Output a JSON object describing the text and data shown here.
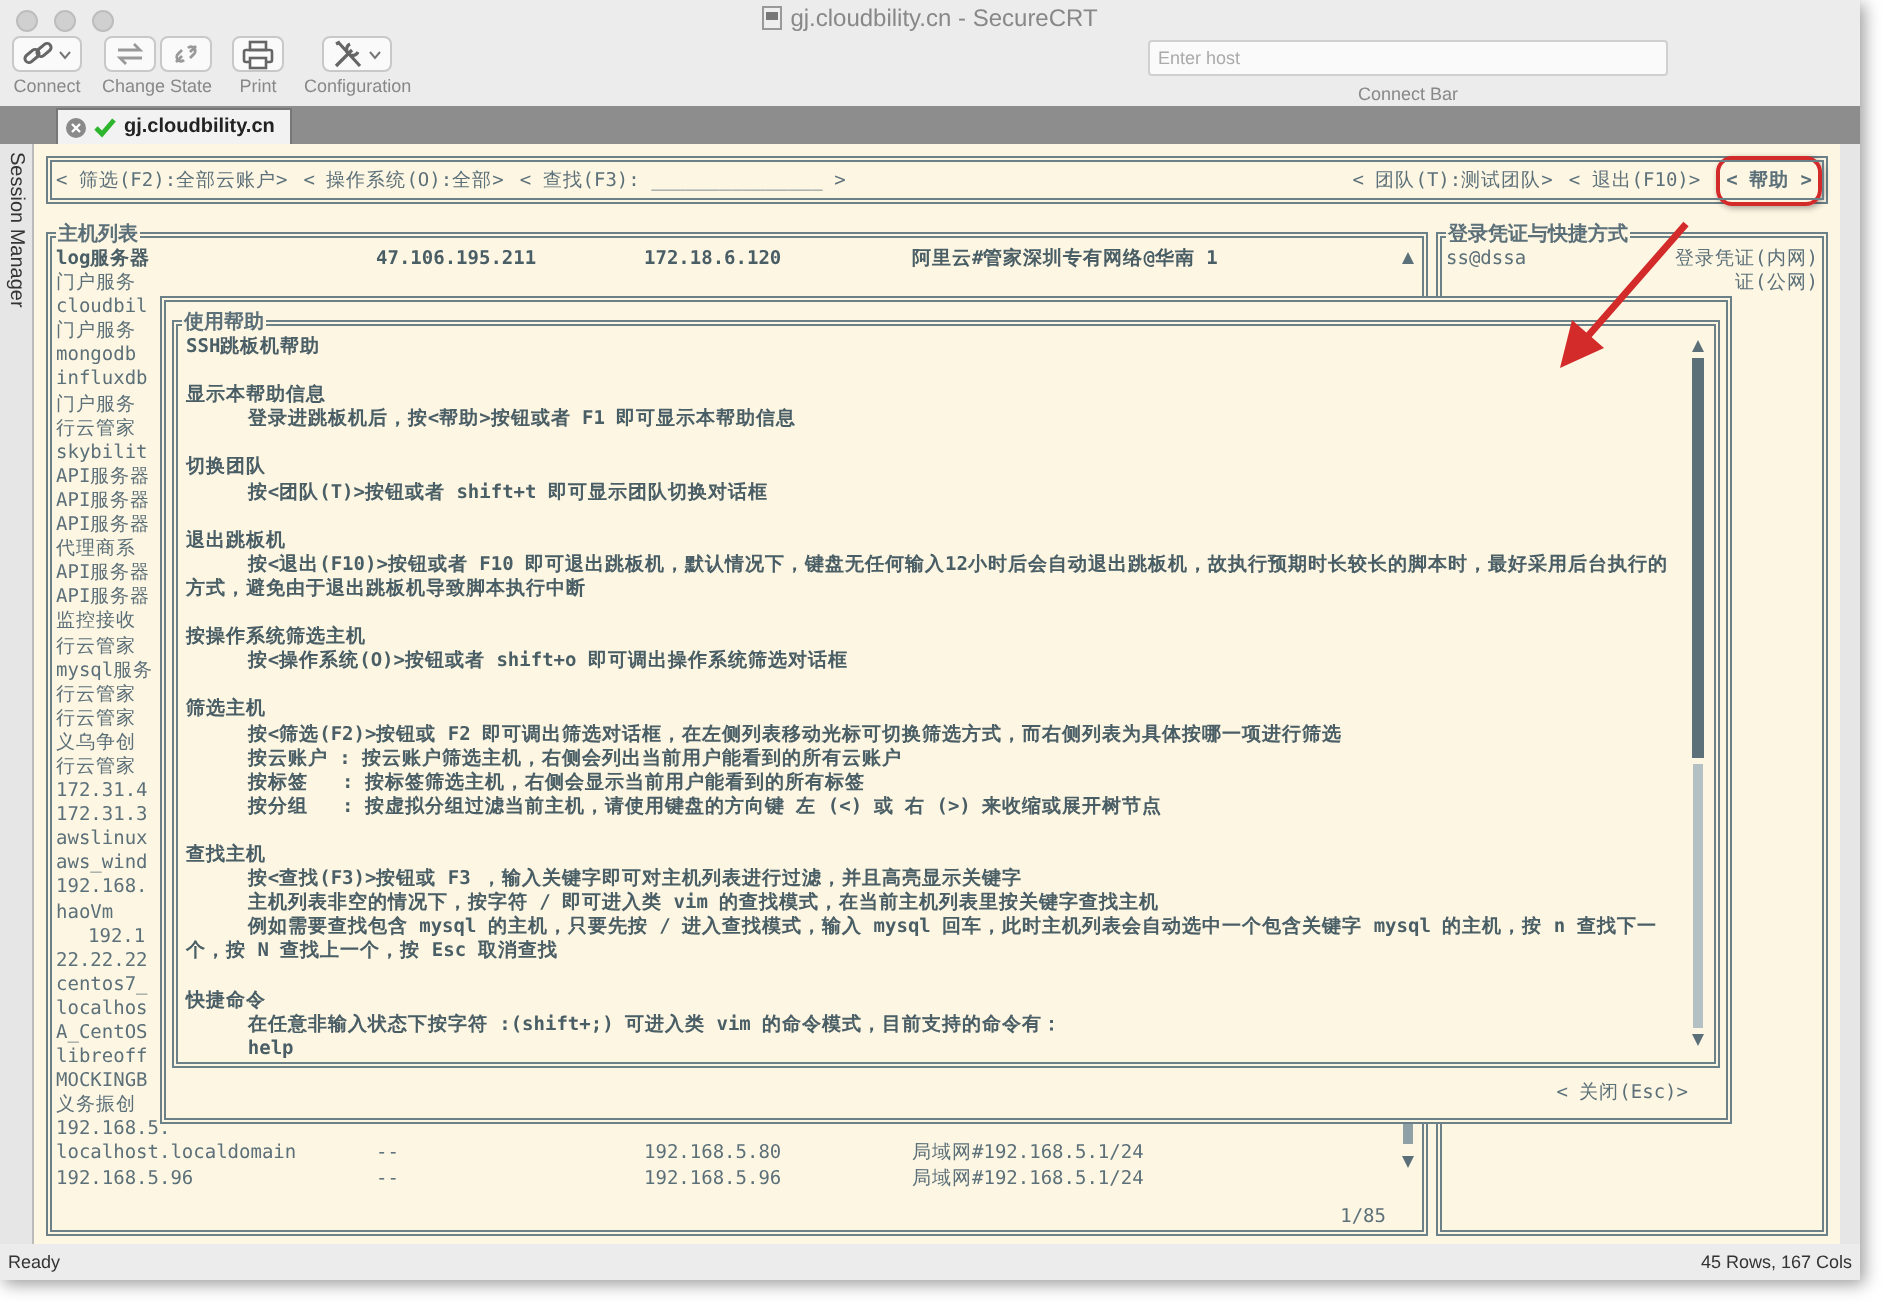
{
  "window": {
    "title": "gj.cloudbility.cn - SecureCRT"
  },
  "toolbar": {
    "buttons": [
      {
        "label": "Connect",
        "kind": "link",
        "dropdown": true
      },
      {
        "label": "Change State",
        "kind": "state",
        "dropdown": false
      },
      {
        "label": "Print",
        "kind": "print",
        "dropdown": false
      },
      {
        "label": "Configuration",
        "kind": "tools",
        "dropdown": true
      }
    ],
    "host_field": {
      "placeholder": "Enter host"
    },
    "connect_bar_label": "Connect Bar"
  },
  "session_tab": {
    "label": "gj.cloudbility.cn",
    "connected": true
  },
  "sidebar": {
    "label": "Session Manager"
  },
  "terminal": {
    "menu_left": [
      {
        "label": "< 筛选(F2):全部云账户>",
        "annotated": false
      },
      {
        "label": "< 操作系统(O):全部>",
        "annotated": false
      },
      {
        "label": "< 查找(F3): _______________ >",
        "annotated": false
      }
    ],
    "menu_right": [
      {
        "label": "< 团队(T):测试团队>",
        "annotated": false
      },
      {
        "label": "< 退出(F10)>",
        "annotated": false
      },
      {
        "label": "< 帮助 >",
        "annotated": true
      }
    ],
    "host_list": {
      "title": "主机列表",
      "rows": [
        {
          "name": "log服务器",
          "public_ip": "47.106.195.211",
          "private_ip": "172.18.6.120",
          "network": "阿里云#管家深圳专有网络@华南 1",
          "selected": true
        },
        {
          "name": "门户服务",
          "selected": false
        },
        {
          "name": "cloudbil",
          "selected": false
        },
        {
          "name": "门户服务",
          "selected": false
        },
        {
          "name": "mongodb",
          "selected": false
        },
        {
          "name": "influxdb",
          "selected": false
        },
        {
          "name": "门户服务",
          "selected": false
        },
        {
          "name": "行云管家",
          "selected": false
        },
        {
          "name": "skybilit",
          "selected": false
        },
        {
          "name": "API服务器",
          "selected": false
        },
        {
          "name": "API服务器",
          "selected": false
        },
        {
          "name": "API服务器",
          "selected": false
        },
        {
          "name": "代理商系",
          "selected": false
        },
        {
          "name": "API服务器",
          "selected": false
        },
        {
          "name": "API服务器",
          "selected": false
        },
        {
          "name": "监控接收",
          "selected": false
        },
        {
          "name": "行云管家",
          "selected": false
        },
        {
          "name": "mysql服务",
          "selected": false
        },
        {
          "name": "行云管家",
          "selected": false
        },
        {
          "name": "行云管家",
          "selected": false
        },
        {
          "name": "义乌争创",
          "selected": false
        },
        {
          "name": "行云管家",
          "selected": false
        },
        {
          "name": "172.31.4",
          "selected": false
        },
        {
          "name": "172.31.3",
          "selected": false
        },
        {
          "name": "awslinux",
          "selected": false
        },
        {
          "name": "aws_wind",
          "selected": false
        },
        {
          "name": "192.168.",
          "selected": false
        },
        {
          "name": "haoVm",
          "selected": false,
          "children": [
            {
              "name": "192.1",
              "selected": false
            }
          ]
        },
        {
          "name": "22.22.22",
          "selected": false
        },
        {
          "name": "centos7_",
          "selected": false
        },
        {
          "name": "localhos",
          "selected": false
        },
        {
          "name": "A_CentOS",
          "selected": false
        },
        {
          "name": "libreoff",
          "selected": false
        },
        {
          "name": "MOCKINGB",
          "selected": false
        },
        {
          "name": "义务振创",
          "selected": false
        },
        {
          "name": "192.168.5.",
          "selected": false
        },
        {
          "name": "localhost.localdomain",
          "public_ip": "--",
          "private_ip": "192.168.5.80",
          "network": "局域网#192.168.5.1/24",
          "selected": false
        },
        {
          "name": "192.168.5.96",
          "public_ip": "--",
          "private_ip": "192.168.5.96",
          "network": "局域网#192.168.5.1/24",
          "selected": false
        }
      ],
      "page": "1/85"
    },
    "credentials": {
      "title": "登录凭证与快捷方式",
      "rows": [
        {
          "user": "ss@dssa",
          "label": "登录凭证(内网)"
        },
        {
          "label": "证(公网)"
        }
      ]
    },
    "help_dialog": {
      "title": "使用帮助",
      "heading": "SSH跳板机帮助",
      "sections": [
        {
          "heading": "显示本帮助信息",
          "lines": [
            "登录进跳板机后，按<帮助>按钮或者 F1 即可显示本帮助信息"
          ]
        },
        {
          "heading": "切换团队",
          "lines": [
            "按<团队(T)>按钮或者 shift+t 即可显示团队切换对话框"
          ]
        },
        {
          "heading": "退出跳板机",
          "lines": [
            "按<退出(F10)>按钮或者 F10 即可退出跳板机，默认情况下，键盘无任何输入12小时后会自动退出跳板机，故执行预期时长较长的脚本时，最好采用后台执行的方式，避免由于退出跳板机导致脚本执行中断"
          ]
        },
        {
          "heading": "按操作系统筛选主机",
          "lines": [
            "按<操作系统(O)>按钮或者 shift+o 即可调出操作系统筛选对话框"
          ]
        },
        {
          "heading": "筛选主机",
          "lines": [
            "按<筛选(F2)>按钮或 F2 即可调出筛选对话框，在左侧列表移动光标可切换筛选方式，而右侧列表为具体按哪一项进行筛选",
            "按云账户 : 按云账户筛选主机，右侧会列出当前用户能看到的所有云账户",
            "按标签   : 按标签筛选主机，右侧会显示当前用户能看到的所有标签",
            "按分组   : 按虚拟分组过滤当前主机，请使用键盘的方向键 左 (<) 或 右 (>) 来收缩或展开树节点"
          ]
        },
        {
          "heading": "查找主机",
          "lines": [
            "按<查找(F3)>按钮或 F3 ，输入关键字即可对主机列表进行过滤，并且高亮显示关键字",
            "主机列表非空的情况下，按字符 / 即可进入类 vim 的查找模式，在当前主机列表里按关键字查找主机",
            "例如需要查找包含 mysql 的主机，只要先按 / 进入查找模式，输入 mysql 回车，此时主机列表会自动选中一个包含关键字 mysql 的主机，按 n 查找下一个，按 N 查找上一个，按 Esc 取消查找"
          ]
        },
        {
          "heading": "快捷命令",
          "lines": [
            "在任意非输入状态下按字符 :(shift+;) 可进入类 vim 的命令模式，目前支持的命令有：",
            "help"
          ]
        }
      ],
      "close": "< 关闭(Esc)>"
    }
  },
  "status_bar": {
    "left": "Ready",
    "right": "45 Rows, 167 Cols"
  }
}
